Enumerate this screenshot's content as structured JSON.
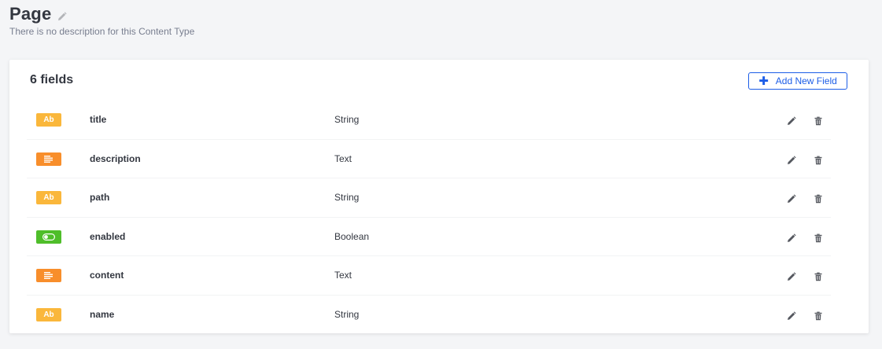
{
  "header": {
    "title": "Page",
    "description": "There is no description for this Content Type",
    "edit_icon": "pencil-icon"
  },
  "fields_panel": {
    "count_label": "6 fields",
    "add_button_label": "Add New Field",
    "add_icon": "plus-icon",
    "accent_color": "#1c5de7"
  },
  "fields": [
    {
      "name": "title",
      "type": "String",
      "badge_text": "Ab",
      "badge_icon": "text-string-icon",
      "badge_color": "#fab73b"
    },
    {
      "name": "description",
      "type": "Text",
      "badge_text": "",
      "badge_icon": "text-paragraph-icon",
      "badge_color": "#f88e2b"
    },
    {
      "name": "path",
      "type": "String",
      "badge_text": "Ab",
      "badge_icon": "text-string-icon",
      "badge_color": "#fab73b"
    },
    {
      "name": "enabled",
      "type": "Boolean",
      "badge_text": "",
      "badge_icon": "toggle-icon",
      "badge_color": "#4fbe2a"
    },
    {
      "name": "content",
      "type": "Text",
      "badge_text": "",
      "badge_icon": "text-paragraph-icon",
      "badge_color": "#f88e2b"
    },
    {
      "name": "name",
      "type": "String",
      "badge_text": "Ab",
      "badge_icon": "text-string-icon",
      "badge_color": "#fab73b"
    }
  ],
  "row_actions": {
    "edit_icon": "pencil-icon",
    "delete_icon": "trash-icon"
  }
}
